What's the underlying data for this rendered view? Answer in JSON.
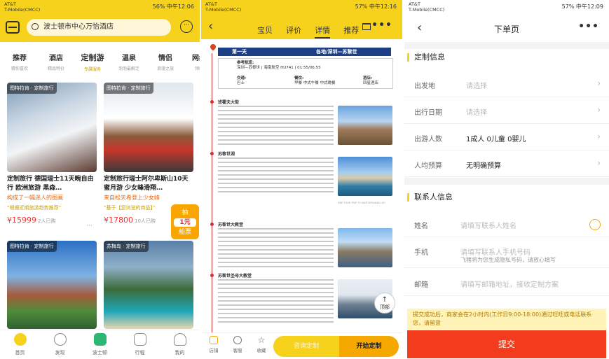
{
  "status_bars": [
    {
      "carrier": "AT&T",
      "carrier2": "T-Mobile(CMCC)",
      "right": "56%  中午12:06"
    },
    {
      "carrier": "AT&T",
      "carrier2": "T-Mobile(CMCC)",
      "right": "57%  中午12:16"
    },
    {
      "carrier": "AT&T",
      "carrier2": "T-Mobile(CMCC)",
      "right": "57%  中午12:09"
    }
  ],
  "screen1": {
    "search_placeholder": "波士顿市中心万怡酒店",
    "message_icon": "chat-bubble-icon",
    "categories": [
      {
        "label": "推荐",
        "sub": "猜你喜欢"
      },
      {
        "label": "酒店",
        "sub": "精品特价"
      },
      {
        "label": "定制游",
        "sub": "专属服务"
      },
      {
        "label": "温泉",
        "sub": "泡泡最解乏"
      },
      {
        "label": "情侣",
        "sub": "浪漫之旅"
      },
      {
        "label": "网红",
        "sub": "领略"
      }
    ],
    "cards": [
      {
        "tag": "图特拉肯 · 定制旅行",
        "title": "定制旅行 德国瑞士11天畹自由行 欧洲旅游 黑森…",
        "highlight": "构成了一幅迷人的图画",
        "quote": "“根据近期旅游趋势推荐”",
        "price": "¥15999",
        "sold": "2人已购",
        "more": "···"
      },
      {
        "tag": "图特拉肯 · 定制旅行",
        "title": "定制旅行瑞士阿尔卑斯山10天蜜月游 少女峰滑翔…",
        "highlight": "来自松天希登上少女峰",
        "quote": "“基于【您浏览的商品】”",
        "price": "¥17800",
        "sold": "10人已购",
        "more": ""
      },
      {
        "tag": "图特拉肯 · 定制旅行"
      },
      {
        "tag": "苏梅岛 · 定制旅行"
      }
    ],
    "badge_top": "抽",
    "badge_value": "1元",
    "badge_bottom": "船票",
    "tabbar": [
      {
        "label": "首页",
        "icon": "home-icon"
      },
      {
        "label": "发现",
        "icon": "discover-icon"
      },
      {
        "label": "波士顿",
        "icon": "location-icon"
      },
      {
        "label": "行程",
        "icon": "luggage-icon"
      },
      {
        "label": "我的",
        "icon": "profile-icon"
      }
    ]
  },
  "screen2": {
    "tabs": [
      "宝贝",
      "评价",
      "详情",
      "推荐"
    ],
    "day_label": "第一天",
    "route": "各地/深圳—苏黎世",
    "info": {
      "flight_label": "参考航班:",
      "flight": "深圳—苏黎世  |  海南航空 HU741  |  01:55/06:55",
      "transport_label": "交通:",
      "transport": "巴士",
      "meals_label": "餐饮:",
      "meals": "早餐 中式午餐 中式晚餐",
      "hotel_label": "酒店:",
      "hotel": "四星酒店"
    },
    "sections": [
      "班霍夫大街",
      "苏黎世湖",
      "苏黎世大教堂",
      "苏黎世圣母大教堂"
    ],
    "caption": "DEE TOUR  TRIP TO SWITZERLAND LSO",
    "top_button": "顶部",
    "bottom_bar": [
      {
        "label": "店铺",
        "icon": "shop-icon"
      },
      {
        "label": "客服",
        "icon": "chat-icon"
      },
      {
        "label": "收藏",
        "icon": "star-icon"
      }
    ],
    "consult_button": "咨询定制",
    "start_button": "开始定制"
  },
  "screen3": {
    "title": "下单页",
    "section1": "定制信息",
    "rows1": [
      {
        "label": "出发地",
        "value": "请选择",
        "filled": false
      },
      {
        "label": "出行日期",
        "value": "请选择",
        "filled": false
      },
      {
        "label": "出游人数",
        "value": "1成人  0儿童  0婴儿",
        "filled": true
      },
      {
        "label": "人均预算",
        "value": "无明确预算",
        "filled": true
      }
    ],
    "section2": "联系人信息",
    "name_label": "姓名",
    "name_placeholder": "请填写联系人姓名",
    "phone_label": "手机",
    "phone_placeholder": "请填写联系人手机号码",
    "phone_hint": "飞猪将为您生成隐私号码，请放心填写",
    "email_label": "邮箱",
    "email_placeholder": "请填写邮箱地址，接收定制方案",
    "notice": "提交成功后，商家会在2小时内(工作日9:00-18:00)通过旺旺或电话联系您，请留意",
    "submit": "提交"
  }
}
